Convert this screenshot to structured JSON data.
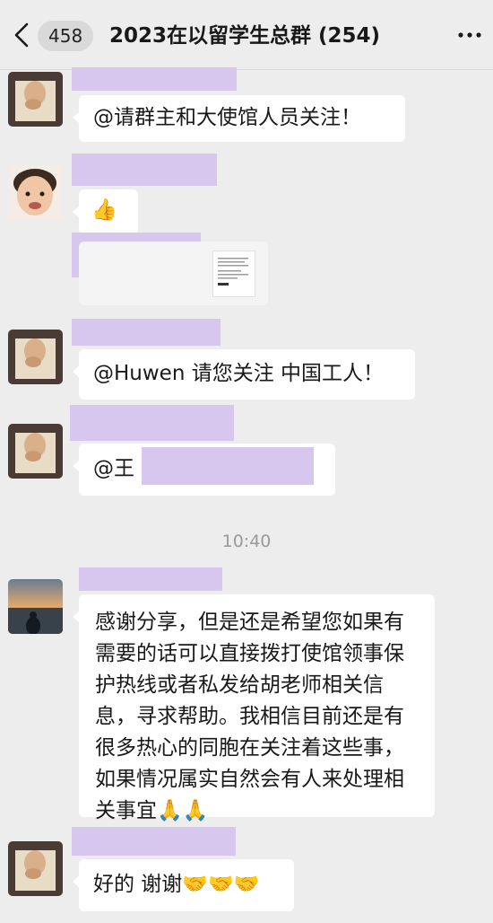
{
  "header": {
    "unread_count": "458",
    "title": "2023在以留学生总群 (254)"
  },
  "messages": [
    {
      "text": "@请群主和大使馆人员关注！"
    },
    {
      "text": "👍"
    },
    {
      "text": ""
    },
    {
      "text": "@Huwen 请您关注 中国工人！"
    },
    {
      "text": "@王"
    },
    {
      "text": "感谢分享，但是还是希望您如果有需要的话可以直接拨打使馆领事保护热线或者私发给胡老师相关信息，寻求帮助。我相信目前还是有很多热心的同胞在关注着这些事，如果情况属实自然会有人来处理相关事宜🙏🙏"
    },
    {
      "text": "好的 谢谢🤝🤝🤝"
    }
  ],
  "timestamp": "10:40",
  "colors": {
    "background": "#ededed",
    "bubble": "#ffffff",
    "redaction": "#d7c6ee",
    "timestamp": "#9a9a9a"
  },
  "icons": [
    "back-chevron-icon",
    "more-dots-icon"
  ]
}
